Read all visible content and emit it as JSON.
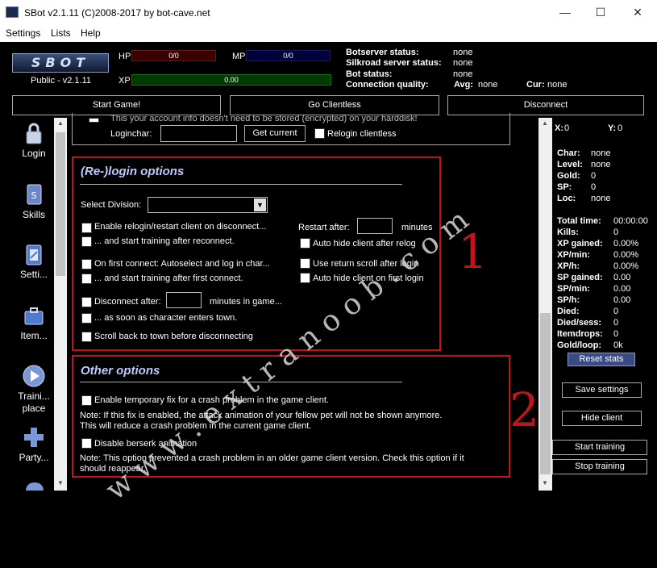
{
  "window": {
    "title": "SBot v2.1.11 (C)2008-2017 by bot-cave.net",
    "min": "—",
    "max": "☐",
    "close": "✕"
  },
  "menu": [
    "Settings",
    "Lists",
    "Help"
  ],
  "header": {
    "logo": "SBOT",
    "version": "Public - v2.1.11",
    "hp_label": "HP",
    "hp_value": "0/0",
    "mp_label": "MP",
    "mp_value": "0/0",
    "xp_label": "XP",
    "xp_value": "0.00",
    "botserver_label": "Botserver status:",
    "botserver_value": "none",
    "silkroad_label": "Silkroad server status:",
    "silkroad_value": "none",
    "botstatus_label": "Bot status:",
    "botstatus_value": "none",
    "conn_label": "Connection quality:",
    "avg_label": "Avg:",
    "avg_value": "none",
    "cur_label": "Cur:",
    "cur_value": "none"
  },
  "buttons": {
    "start_game": "Start Game!",
    "clientless": "Go Clientless",
    "disconnect": "Disconnect"
  },
  "sidebar": [
    {
      "label": "Login"
    },
    {
      "label": "Skills"
    },
    {
      "label": "Setti..."
    },
    {
      "label": "Item..."
    },
    {
      "label": "Traini... place"
    },
    {
      "label": "Party..."
    }
  ],
  "top_section": {
    "partial_text": "This your account info doesn't need to be stored (encrypted) on your harddisk!",
    "loginchar_label": "Loginchar:",
    "get_current": "Get current",
    "relogin_clientless": "Relogin clientless"
  },
  "relogin": {
    "title": "(Re-)login options",
    "division_label": "Select Division:",
    "enable_relogin": "Enable relogin/restart client on disconnect...",
    "start_training_reconnect": "... and start training after reconnect.",
    "first_connect": "On first connect: Autoselect and log in char...",
    "start_training_first": "... and start training after first connect.",
    "disconnect_after": "Disconnect after:",
    "minutes_in_game": "minutes in game...",
    "as_soon": "... as soon as character enters town.",
    "scroll_back": "Scroll back to town before disconnecting",
    "restart_after": "Restart after:",
    "minutes": "minutes",
    "auto_hide_relog": "Auto hide client after relog",
    "use_return_scroll": "Use return scroll after login",
    "auto_hide_first": "Auto hide client on first login"
  },
  "other": {
    "title": "Other options",
    "enable_fix": "Enable temporary fix for a crash problem in the game client.",
    "note1_line1": "Note: If this fix is enabled, the attack animation of your fellow pet will not be shown anymore.",
    "note1_line2": "This will reduce a crash problem in the current game client.",
    "disable_berserk": "Disable berserk animation",
    "note2_line1": "Note: This option prevented a crash problem in an older game client version. Check this option if it",
    "note2_line2": "should reappear."
  },
  "right": {
    "x_label": "X:",
    "x_value": "0",
    "y_label": "Y:",
    "y_value": "0",
    "char": [
      "Char:",
      "none"
    ],
    "level": [
      "Level:",
      "none"
    ],
    "gold": [
      "Gold:",
      "0"
    ],
    "sp": [
      "SP:",
      "0"
    ],
    "loc": [
      "Loc:",
      "none"
    ],
    "total_time": [
      "Total time:",
      "00:00:00"
    ],
    "kills": [
      "Kills:",
      "0"
    ],
    "xp_gained": [
      "XP gained:",
      "0.00%"
    ],
    "xp_min": [
      "XP/min:",
      "0.00%"
    ],
    "xp_h": [
      "XP/h:",
      "0.00%"
    ],
    "sp_gained": [
      "SP gained:",
      "0.00"
    ],
    "sp_min": [
      "SP/min:",
      "0.00"
    ],
    "sp_h": [
      "SP/h:",
      "0.00"
    ],
    "died": [
      "Died:",
      "0"
    ],
    "died_sess": [
      "Died/sess:",
      "0"
    ],
    "itemdrops": [
      "Itemdrops:",
      "0"
    ],
    "gold_loop": [
      "Gold/loop:",
      "0k"
    ],
    "reset_stats": "Reset stats",
    "save_settings": "Save settings",
    "hide_client": "Hide client",
    "start_training": "Start training",
    "stop_training": "Stop training"
  },
  "annotations": {
    "num1": "1",
    "num2": "2",
    "watermark": "w w w . e x t r a n o o b . c o m"
  }
}
